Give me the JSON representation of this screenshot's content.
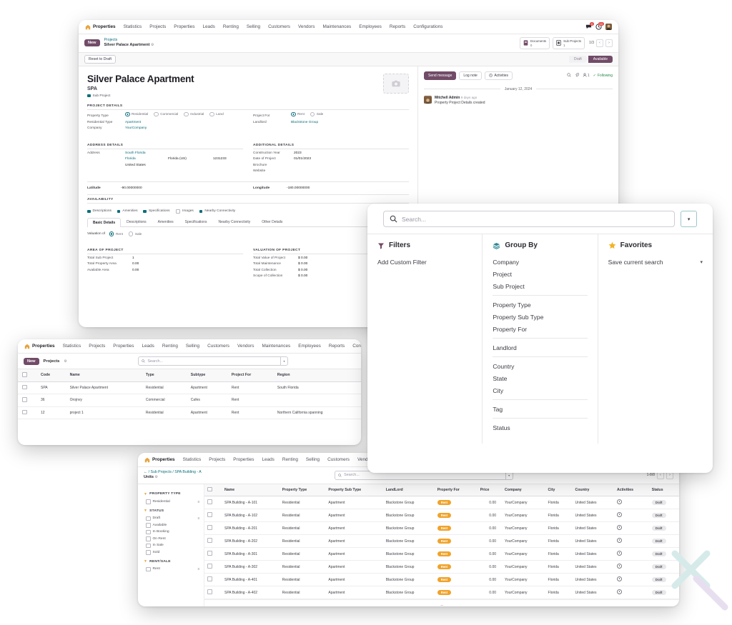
{
  "app": {
    "brand": "Properties",
    "menu": [
      "Statistics",
      "Projects",
      "Properties",
      "Leads",
      "Renting",
      "Selling",
      "Customers",
      "Vendors",
      "Maintenances",
      "Employees",
      "Reports",
      "Configurations"
    ],
    "brand_icon": "home-icon",
    "sysicons": [
      "message-icon",
      "activity-icon",
      "user-avatar"
    ],
    "badge_counts": [
      "0",
      "10"
    ]
  },
  "window_form": {
    "new_button": "New",
    "breadcrumb_parent": "Projects",
    "breadcrumb_current": "Silver Palace Apartment",
    "stat_buttons": [
      {
        "label": "Documents",
        "value": "0",
        "icon": "documents-icon"
      },
      {
        "label": "Sub Projects",
        "value": "1",
        "icon": "sub-projects-icon"
      }
    ],
    "pager": "1/3",
    "reset_button": "Reset to Draft",
    "statuses": [
      "Draft",
      "Available"
    ],
    "active_status": "Available",
    "title": "Silver Palace Apartment",
    "code": "SPA",
    "sub_project_checkbox": "Sub Project",
    "sections": {
      "project_details": {
        "title": "PROJECT DETAILS",
        "property_type_label": "Property Type",
        "property_type_options": [
          "Residential",
          "Commercial",
          "Industrial",
          "Land"
        ],
        "property_type_value": "Residential",
        "residential_type_label": "Residential Type",
        "residential_type_value": "Apartment",
        "company_label": "Company",
        "company_value": "YourCompany",
        "project_for_label": "Project For",
        "project_for_options": [
          "Rent",
          "Sale"
        ],
        "project_for_value": "Rent",
        "landlord_label": "Landlord",
        "landlord_value": "Blackstone Group"
      },
      "address_details": {
        "title": "ADDRESS DETAILS",
        "address_label": "Address",
        "street": "South Florida",
        "city": "Florida",
        "state": "Florida (US)",
        "zip": "1231233",
        "country": "United States",
        "latitude_label": "Latitude",
        "latitude_value": "-90.00000000"
      },
      "additional_details": {
        "title": "ADDITIONAL DETAILS",
        "rows": [
          {
            "label": "Construction Year",
            "value": "2023"
          },
          {
            "label": "Date of Project",
            "value": "01/01/2023"
          },
          {
            "label": "Brochure",
            "value": ""
          },
          {
            "label": "Website",
            "value": ""
          }
        ],
        "longitude_label": "Longitude",
        "longitude_value": "-180.00000000"
      },
      "availability": {
        "title": "AVAILABILITY",
        "checkboxes": [
          {
            "label": "Descriptions",
            "checked": true
          },
          {
            "label": "Amenities",
            "checked": true
          },
          {
            "label": "Specifications",
            "checked": true
          },
          {
            "label": "Images",
            "checked": false
          },
          {
            "label": "Nearby Connectivity",
            "checked": true
          }
        ],
        "tabs": [
          "Basic Details",
          "Descriptions",
          "Amenities",
          "Specifications",
          "Nearby Connectivity",
          "Other Details"
        ],
        "active_tab": "Basic Details",
        "valuation_label": "Valuation of",
        "valuation_options": [
          "Rent",
          "Sale"
        ],
        "valuation_value": "Rent"
      },
      "area_of_project": {
        "title": "AREA OF PROJECT",
        "rows": [
          {
            "label": "Total Sub Project",
            "value": "1"
          },
          {
            "label": "Total Property Area",
            "value": "0.00"
          },
          {
            "label": "Available Area",
            "value": "0.00"
          }
        ]
      },
      "valuation_of_project": {
        "title": "VALUATION OF PROJECT",
        "rows": [
          {
            "label": "Total Value of Project",
            "value": "$ 0.00"
          },
          {
            "label": "Total Maintenance",
            "value": "$ 0.00"
          },
          {
            "label": "Total Collection",
            "value": "$ 0.00"
          },
          {
            "label": "Scope of Collection",
            "value": "$ 0.00"
          }
        ]
      }
    },
    "chatter": {
      "send_message": "Send message",
      "log_note": "Log note",
      "activities": "Activities",
      "follower_count": "1",
      "following": "Following",
      "date_separator": "January 12, 2024",
      "message_author": "Mitchell Admin",
      "message_time": "9 days ago",
      "message_body": "Property Project Details created"
    }
  },
  "window_list": {
    "new_button": "New",
    "breadcrumb_current": "Projects",
    "search_placeholder": "Search...",
    "columns": [
      "Code",
      "Name",
      "Type",
      "Subtype",
      "Project For",
      "Region"
    ],
    "rows": [
      {
        "code": "SPA",
        "name": "Silver Palace Apartment",
        "type": "Residential",
        "subtype": "Apartment",
        "project_for": "Rent",
        "region": "South Florida"
      },
      {
        "code": "36",
        "name": "Orojnvy",
        "type": "Commercial",
        "subtype": "Cafes",
        "project_for": "Rent",
        "region": ""
      },
      {
        "code": "12",
        "name": "project 1",
        "type": "Residential",
        "subtype": "Apartment",
        "project_for": "Rent",
        "region": "Northern California spanning"
      }
    ]
  },
  "search_dialog": {
    "search_placeholder": "Search...",
    "filters_title": "Filters",
    "filters_items": [
      "Add Custom Filter"
    ],
    "groupby_title": "Group By",
    "groupby_groups": [
      [
        "Company",
        "Project",
        "Sub Project"
      ],
      [
        "Property Type",
        "Property Sub Type",
        "Property For"
      ],
      [
        "Landlord"
      ],
      [
        "Country",
        "State",
        "City"
      ],
      [
        "Tag"
      ],
      [
        "Status"
      ]
    ],
    "favorites_title": "Favorites",
    "favorites_item": "Save current search"
  },
  "window_units": {
    "breadcrumb": [
      "Sub Projects",
      "SPA Building - A"
    ],
    "breadcrumb_current": "Units",
    "search_placeholder": "Search...",
    "pager": "1-8/8",
    "sidebar": [
      {
        "title": "PROPERTY TYPE",
        "items": [
          {
            "label": "Residential",
            "count": "8"
          }
        ]
      },
      {
        "title": "STATUS",
        "items": [
          {
            "label": "Draft",
            "count": "8"
          },
          {
            "label": "Available",
            "count": ""
          },
          {
            "label": "In Booking",
            "count": ""
          },
          {
            "label": "On Rent",
            "count": ""
          },
          {
            "label": "In Sale",
            "count": ""
          },
          {
            "label": "Sold",
            "count": ""
          }
        ]
      },
      {
        "title": "RENT/SALE",
        "items": [
          {
            "label": "Rent",
            "count": "8"
          }
        ]
      }
    ],
    "columns": [
      "Name",
      "Property Type",
      "Property Sub Type",
      "LandLord",
      "Property For",
      "Price",
      "Company",
      "City",
      "Country",
      "Activities",
      "Status"
    ],
    "rows": [
      {
        "name": "SPA Building - A-101",
        "property_type": "Residential",
        "property_sub_type": "Apartment",
        "landlord": "Blackstone Group",
        "property_for": "Rent",
        "price": "0.00",
        "company": "YourCompany",
        "city": "Florida",
        "country": "United States",
        "status": "Draft"
      },
      {
        "name": "SPA Building - A-102",
        "property_type": "Residential",
        "property_sub_type": "Apartment",
        "landlord": "Blackstone Group",
        "property_for": "Rent",
        "price": "0.00",
        "company": "YourCompany",
        "city": "Florida",
        "country": "United States",
        "status": "Draft"
      },
      {
        "name": "SPA Building - A-201",
        "property_type": "Residential",
        "property_sub_type": "Apartment",
        "landlord": "Blackstone Group",
        "property_for": "Rent",
        "price": "0.00",
        "company": "YourCompany",
        "city": "Florida",
        "country": "United States",
        "status": "Draft"
      },
      {
        "name": "SPA Building - A-202",
        "property_type": "Residential",
        "property_sub_type": "Apartment",
        "landlord": "Blackstone Group",
        "property_for": "Rent",
        "price": "0.00",
        "company": "YourCompany",
        "city": "Florida",
        "country": "United States",
        "status": "Draft"
      },
      {
        "name": "SPA Building - A-301",
        "property_type": "Residential",
        "property_sub_type": "Apartment",
        "landlord": "Blackstone Group",
        "property_for": "Rent",
        "price": "0.00",
        "company": "YourCompany",
        "city": "Florida",
        "country": "United States",
        "status": "Draft"
      },
      {
        "name": "SPA Building - A-302",
        "property_type": "Residential",
        "property_sub_type": "Apartment",
        "landlord": "Blackstone Group",
        "property_for": "Rent",
        "price": "0.00",
        "company": "YourCompany",
        "city": "Florida",
        "country": "United States",
        "status": "Draft"
      },
      {
        "name": "SPA Building - A-401",
        "property_type": "Residential",
        "property_sub_type": "Apartment",
        "landlord": "Blackstone Group",
        "property_for": "Rent",
        "price": "0.00",
        "company": "YourCompany",
        "city": "Florida",
        "country": "United States",
        "status": "Draft"
      },
      {
        "name": "SPA Building - A-402",
        "property_type": "Residential",
        "property_sub_type": "Apartment",
        "landlord": "Blackstone Group",
        "property_for": "Rent",
        "price": "0.00",
        "company": "YourCompany",
        "city": "Florida",
        "country": "United States",
        "status": "Draft"
      }
    ],
    "footer_dash": "–"
  },
  "colors": {
    "primary": "#714b67",
    "accent": "#0b6e7b",
    "rent_badge": "#f0a32a",
    "following": "#2a8a4a"
  }
}
